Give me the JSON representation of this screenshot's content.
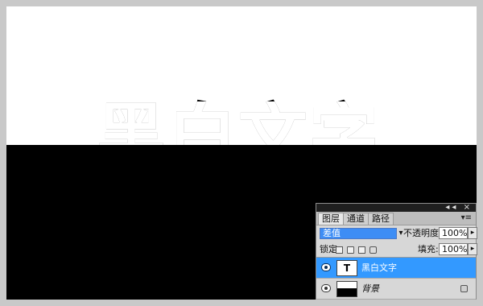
{
  "canvas": {
    "headline": "黑白文字"
  },
  "layers_panel": {
    "tabs": [
      "图层",
      "通道",
      "路径"
    ],
    "blend_mode": "差值",
    "opacity_label": "不透明度:",
    "opacity_value": "100%",
    "lock_label": "锁定:",
    "fill_label": "填充:",
    "fill_value": "100%",
    "layers": [
      {
        "name": "黑白文字",
        "thumb_text": "T",
        "selected": true
      },
      {
        "name": "背景",
        "thumb_text": "",
        "selected": false
      }
    ],
    "panel_controls": "◂◂ ×",
    "menu_icon": "▾≡"
  }
}
